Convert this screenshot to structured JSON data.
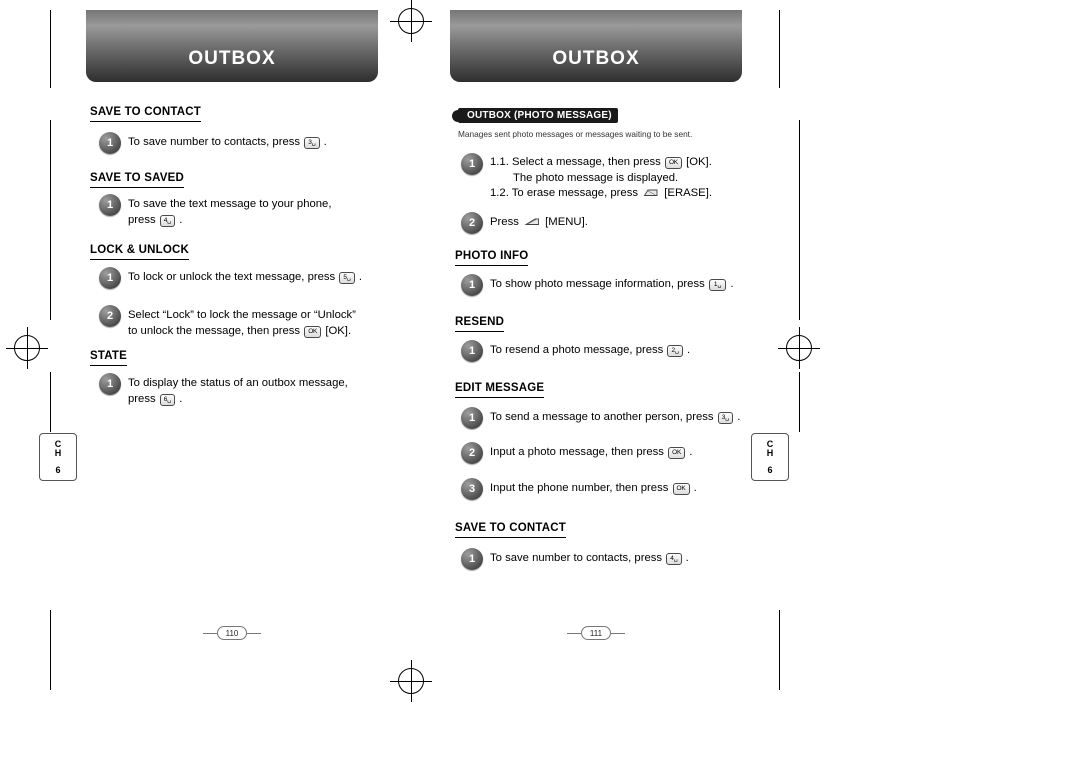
{
  "document": {
    "left_page": {
      "banner_title": "OUTBOX",
      "page_number": "110",
      "chapter_tab": {
        "ch_line1": "C",
        "ch_line2": "H",
        "number": "6"
      },
      "sections": [
        {
          "heading": "SAVE TO CONTACT",
          "steps": [
            {
              "num": "1",
              "text_before": "To save number to contacts, press",
              "key": "3",
              "text_after": "."
            }
          ]
        },
        {
          "heading": "SAVE TO SAVED",
          "steps": [
            {
              "num": "1",
              "line1": "To save the text message to your phone,",
              "line2_before": "press",
              "key": "4",
              "line2_after": "."
            }
          ]
        },
        {
          "heading": "LOCK & UNLOCK",
          "steps": [
            {
              "num": "1",
              "text_before": "To lock or unlock the text message, press",
              "key": "5",
              "text_after": "."
            },
            {
              "num": "2",
              "line1": "Select “Lock” to lock the message or “Unlock”",
              "line2_before": "to unlock the message, then press",
              "key": "OK-key",
              "line2_after": "[OK]."
            }
          ]
        },
        {
          "heading": "STATE",
          "steps": [
            {
              "num": "1",
              "line1": "To display the status of an outbox message,",
              "line2_before": "press",
              "key": "6",
              "line2_after": "."
            }
          ]
        }
      ]
    },
    "right_page": {
      "banner_title": "OUTBOX",
      "page_number": "111",
      "chapter_tab": {
        "ch_line1": "C",
        "ch_line2": "H",
        "number": "6"
      },
      "pill_heading": "OUTBOX (PHOTO MESSAGE)",
      "pill_note": "Manages sent photo messages or messages waiting to be sent.",
      "intro_steps": [
        {
          "num": "1",
          "line1_before": "1.1. Select a message, then press",
          "line1_key": "OK-key",
          "line1_after": "[OK].",
          "line2": "The photo message is displayed.",
          "line3_before": "1.2. To erase message, press",
          "line3_key": "ERASE-key",
          "line3_after": "[ERASE]."
        },
        {
          "num": "2",
          "text_before": "Press",
          "key": "MENU-key",
          "text_after": "[MENU]."
        }
      ],
      "sections": [
        {
          "heading": "PHOTO INFO",
          "steps": [
            {
              "num": "1",
              "text_before": "To show photo message information, press",
              "key": "1",
              "text_after": "."
            }
          ]
        },
        {
          "heading": "RESEND",
          "steps": [
            {
              "num": "1",
              "text_before": "To resend a photo message, press",
              "key": "2",
              "text_after": "."
            }
          ]
        },
        {
          "heading": "EDIT MESSAGE",
          "steps": [
            {
              "num": "1",
              "text_before": "To send a message to another person, press",
              "key": "3",
              "text_after": "."
            },
            {
              "num": "2",
              "text_before": "Input a photo message, then press",
              "key": "OK-key",
              "text_after": "."
            },
            {
              "num": "3",
              "text_before": "Input the phone number, then press",
              "key": "OK-key",
              "text_after": "."
            }
          ]
        },
        {
          "heading": "SAVE TO CONTACT",
          "steps": [
            {
              "num": "1",
              "text_before": "To save number to contacts, press",
              "key": "4",
              "text_after": "."
            }
          ]
        }
      ]
    },
    "keys": {
      "k1": "1␣",
      "k2": "2␣",
      "k3": "3␣",
      "k4": "4␣",
      "k5": "5␣",
      "k6": "6␣",
      "ok": "OK"
    }
  }
}
